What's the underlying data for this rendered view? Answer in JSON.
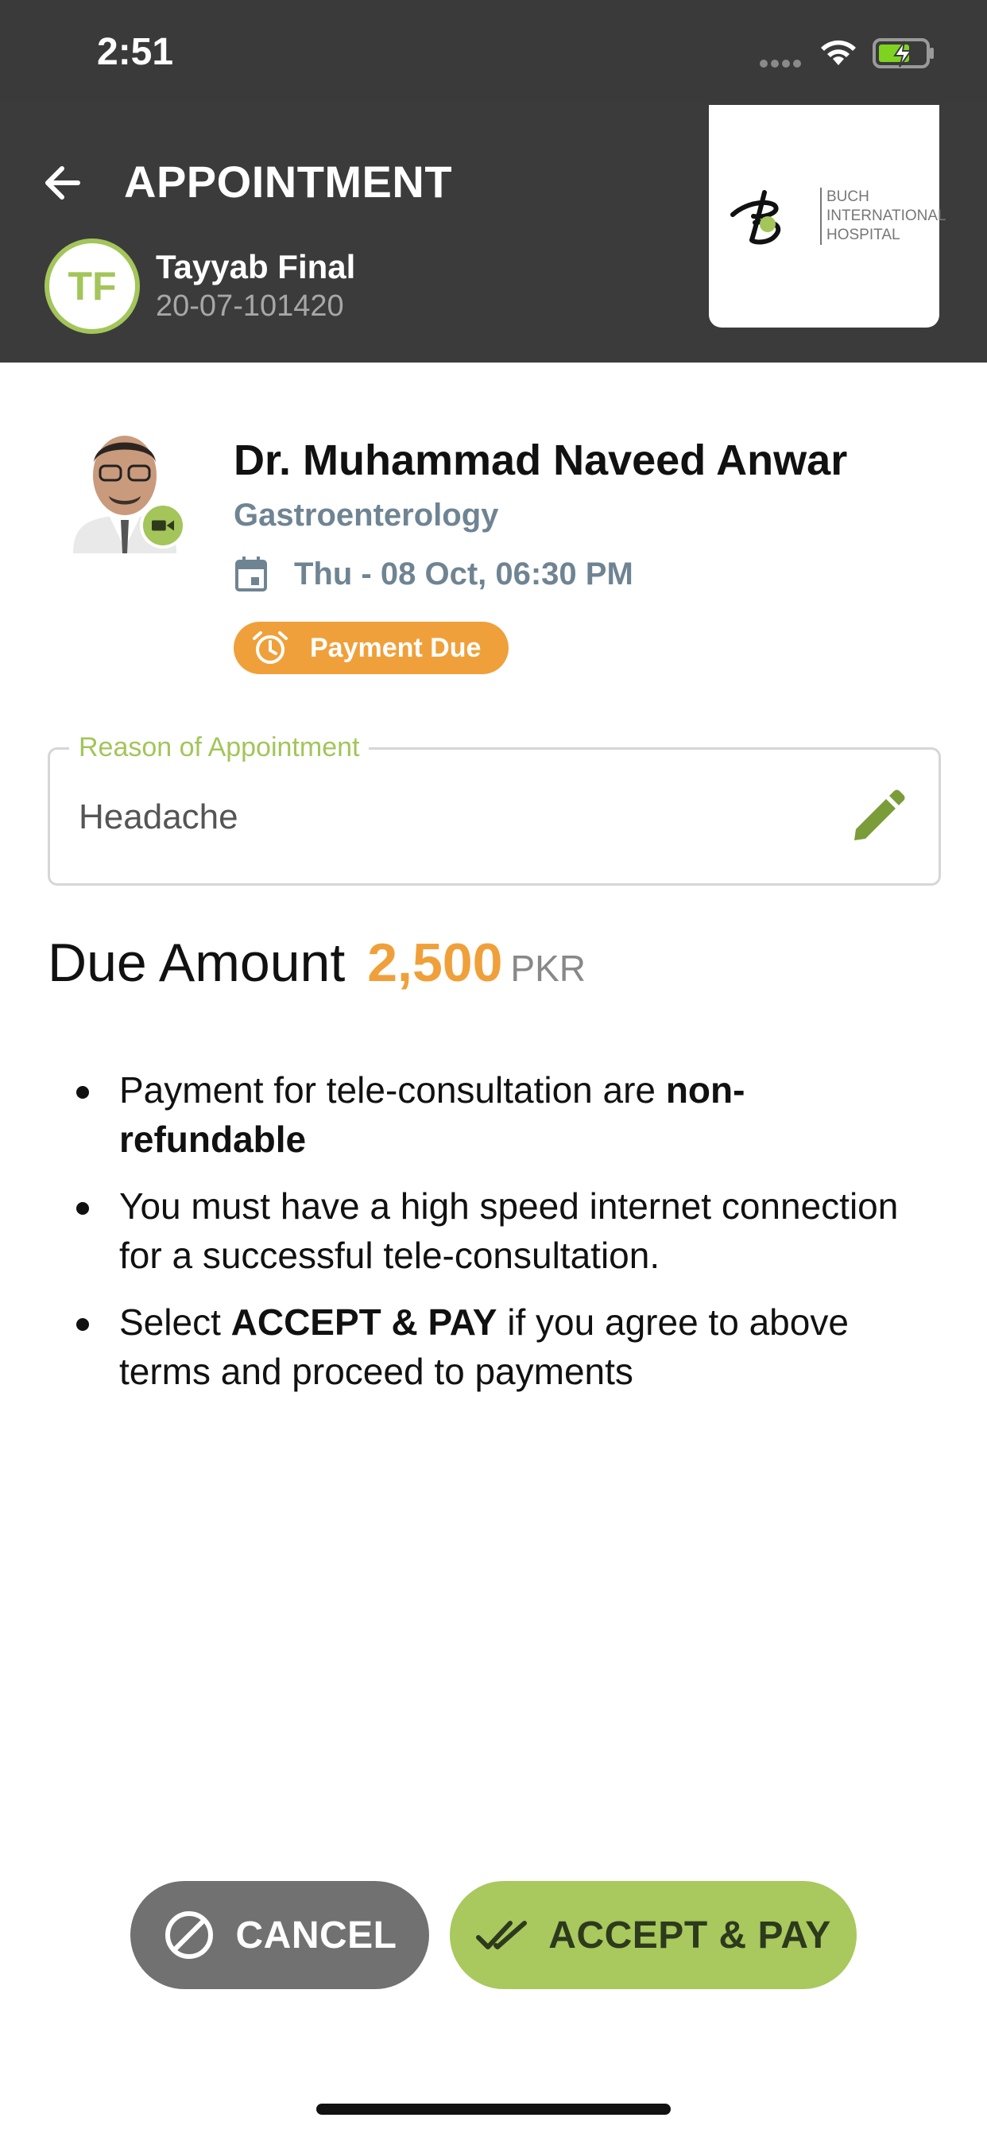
{
  "status_bar": {
    "time": "2:51"
  },
  "header": {
    "title": "APPOINTMENT",
    "patient": {
      "initials": "TF",
      "name": "Tayyab Final",
      "id": "20-07-101420"
    },
    "logo": {
      "text_line1": "BUCH",
      "text_line2": "INTERNATIONAL",
      "text_line3": "HOSPITAL"
    }
  },
  "doctor": {
    "name": "Dr. Muhammad Naveed Anwar",
    "specialty": "Gastroenterology",
    "datetime": "Thu - 08 Oct, 06:30 PM",
    "status": "Payment Due"
  },
  "reason": {
    "label": "Reason of Appointment",
    "value": "Headache"
  },
  "due": {
    "label": "Due Amount",
    "amount": "2,500",
    "currency": "PKR"
  },
  "terms": [
    {
      "text": "Payment for tele-consultation are ",
      "bold": "non-refundable",
      "after": ""
    },
    {
      "text": "You must have a high speed internet connection for a successful tele-consultation.",
      "bold": "",
      "after": ""
    },
    {
      "text": "Select ",
      "bold": "ACCEPT & PAY",
      "after": " if you agree to above terms and proceed to payments"
    }
  ],
  "actions": {
    "cancel_label": "CANCEL",
    "accept_label": "ACCEPT & PAY"
  },
  "colors": {
    "accent_green": "#a3c55a",
    "accent_orange": "#f0a03a",
    "header_bg": "#3b3b3b"
  }
}
